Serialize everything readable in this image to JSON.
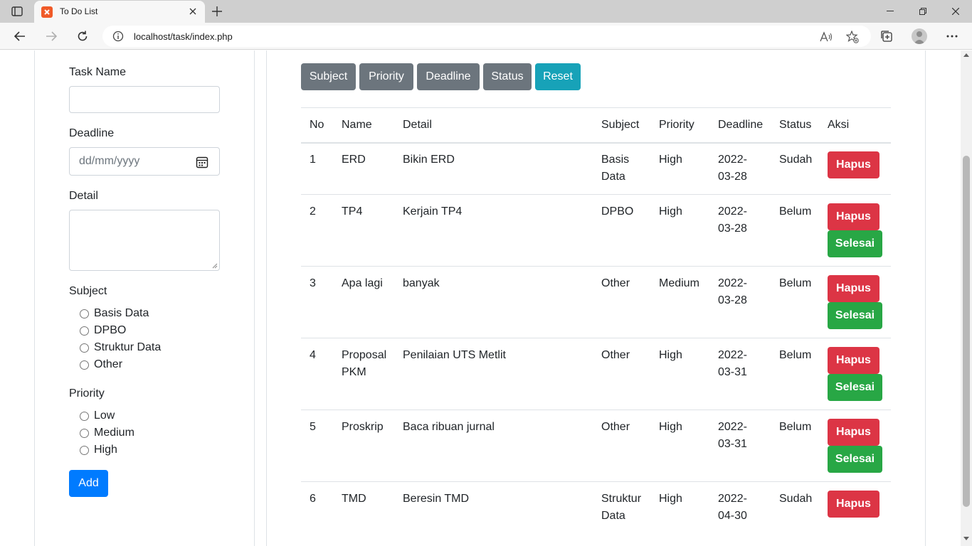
{
  "browser": {
    "tab_title": "To Do List",
    "url": "localhost/task/index.php"
  },
  "form": {
    "task_name_label": "Task Name",
    "task_name_value": "",
    "deadline_label": "Deadline",
    "deadline_placeholder": "dd/mm/yyyy",
    "detail_label": "Detail",
    "detail_value": "",
    "subject_label": "Subject",
    "subject_options": [
      "Basis Data",
      "DPBO",
      "Struktur Data",
      "Other"
    ],
    "priority_label": "Priority",
    "priority_options": [
      "Low",
      "Medium",
      "High"
    ],
    "add_button": "Add"
  },
  "filters": {
    "subject": "Subject",
    "priority": "Priority",
    "deadline": "Deadline",
    "status": "Status",
    "reset": "Reset"
  },
  "colors": {
    "filter_gray": "#6c757d",
    "reset_teal": "#17a2b8",
    "add_blue": "#007bff",
    "hapus_red": "#dc3545",
    "selesai_green": "#28a745"
  },
  "table": {
    "headers": [
      "No",
      "Name",
      "Detail",
      "Subject",
      "Priority",
      "Deadline",
      "Status",
      "Aksi"
    ],
    "hapus_label": "Hapus",
    "selesai_label": "Selesai",
    "rows": [
      {
        "no": "1",
        "name_1": "ERD",
        "name_2": "",
        "detail": "Bikin ERD",
        "subject_1": "Basis",
        "subject_2": "Data",
        "priority": "High",
        "deadline_1": "2022-",
        "deadline_2": "03-28",
        "status": "Sudah"
      },
      {
        "no": "2",
        "name_1": "TP4",
        "name_2": "",
        "detail": "Kerjain TP4",
        "subject_1": "DPBO",
        "subject_2": "",
        "priority": "High",
        "deadline_1": "2022-",
        "deadline_2": "03-28",
        "status": "Belum"
      },
      {
        "no": "3",
        "name_1": "Apa lagi",
        "name_2": "",
        "detail": "banyak",
        "subject_1": "Other",
        "subject_2": "",
        "priority": "Medium",
        "deadline_1": "2022-",
        "deadline_2": "03-28",
        "status": "Belum"
      },
      {
        "no": "4",
        "name_1": "Proposal",
        "name_2": "PKM",
        "detail": "Penilaian UTS Metlit",
        "subject_1": "Other",
        "subject_2": "",
        "priority": "High",
        "deadline_1": "2022-",
        "deadline_2": "03-31",
        "status": "Belum"
      },
      {
        "no": "5",
        "name_1": "Proskrip",
        "name_2": "",
        "detail": "Baca ribuan jurnal",
        "subject_1": "Other",
        "subject_2": "",
        "priority": "High",
        "deadline_1": "2022-",
        "deadline_2": "03-31",
        "status": "Belum"
      },
      {
        "no": "6",
        "name_1": "TMD",
        "name_2": "",
        "detail": "Beresin TMD",
        "subject_1": "Struktur",
        "subject_2": "Data",
        "priority": "High",
        "deadline_1": "2022-",
        "deadline_2": "04-30",
        "status": "Sudah"
      }
    ]
  }
}
